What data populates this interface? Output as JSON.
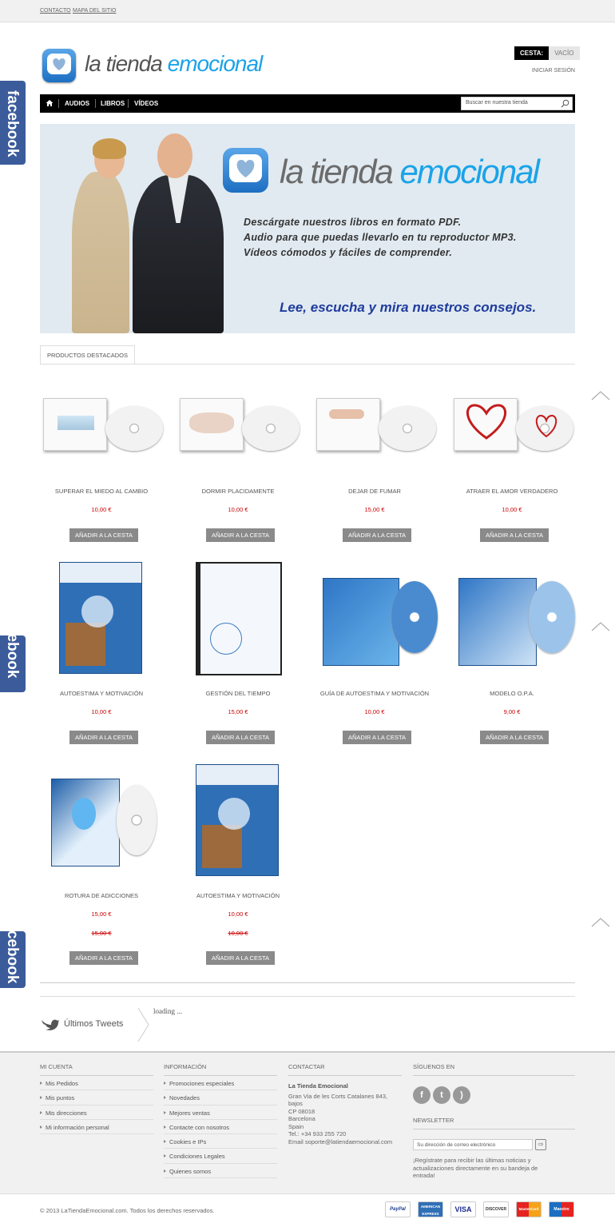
{
  "topbar": {
    "contact": "CONTACTO",
    "sitemap": "MAPA DEL SITIO"
  },
  "logo": {
    "part1": "la tienda ",
    "part2": "emocional"
  },
  "cart": {
    "label": "CESTA:",
    "value": "VACÍO"
  },
  "login": "INICIAR SESIÓN",
  "nav": {
    "items": [
      "AUDIOS",
      "LIBROS",
      "VÍDEOS"
    ]
  },
  "search": {
    "placeholder": "Buscar en nuestra tienda"
  },
  "banner": {
    "logo_part1": "la tienda ",
    "logo_part2": "emocional",
    "line1": "Descárgate nuestros libros en formato PDF.",
    "line2": "Audio para que puedas llevarlo en tu reproductor MP3.",
    "line3": "Vídeos cómodos y fáciles de comprender.",
    "slogan": "Lee, escucha y mira nuestros consejos."
  },
  "tab": "PRODUCTOS DESTACADOS",
  "button_label": "AÑADIR A LA CESTA",
  "products": [
    {
      "name": "SUPERAR EL MIEDO AL CAMBIO",
      "price": "10,00 €"
    },
    {
      "name": "DORMIR PLACIDAMENTE",
      "price": "10,00 €"
    },
    {
      "name": "DEJAR DE FUMAR",
      "price": "15,00 €"
    },
    {
      "name": "ATRAER EL AMOR VERDADERO",
      "price": "10,00 €"
    },
    {
      "name": "AUTOESTIMA Y MOTIVACIÓN",
      "price": "10,00 €"
    },
    {
      "name": "GESTIÓN DEL TIEMPO",
      "price": "15,00 €"
    },
    {
      "name": "GUÍA DE AUTOESTIMA Y MOTIVACIÓN",
      "price": "10,00 €"
    },
    {
      "name": "MODELO O.P.A.",
      "price": "9,00 €"
    },
    {
      "name": "ROTURA DE ADICCIONES",
      "price": "15,00 €",
      "old_price": "15,00 €"
    },
    {
      "name": "AUTOESTIMA Y MOTIVACIÓN",
      "price": "10,00 €",
      "old_price": "10,00 €"
    }
  ],
  "facebook_label": "facebook",
  "tweets": {
    "title": "Últimos Tweets",
    "loading": "loading ..."
  },
  "footer": {
    "account": {
      "title": "MI CUENTA",
      "items": [
        "Mis Pedidos",
        "Mis puntos",
        "Mis direcciones",
        "Mi información personal"
      ]
    },
    "info": {
      "title": "INFORMACIÓN",
      "items": [
        "Promociones especiales",
        "Novedades",
        "Mejores ventas",
        "Contacte con nosotros",
        "Cookies e IPs",
        "Condiciones Legales",
        "Quienes somos"
      ]
    },
    "contact": {
      "title": "CONTACTAR",
      "company": "La Tienda Emocional",
      "address1": "Gran Via de les Corts Catalanes 843, bajos",
      "address2": "CP 08018",
      "address3": "Barcelona",
      "address4": "Spain",
      "phone": "Tel.: +34 933 255 720",
      "email": "Email soporte@latiendaemocional.com"
    },
    "follow": {
      "title": "SÍGUENOS EN"
    },
    "newsletter": {
      "title": "NEWSLETTER",
      "placeholder": "Su dirección de correo electrónico",
      "text": "¡Regístrate para recibir las últimas noticias y actualizaciones directamente en su bandeja de entrada!"
    }
  },
  "copyright": "© 2013 LaTiendaEmocional.com. Todos los derechos reservados.",
  "payments": [
    "PayPal",
    "AMERICAN EXPRESS",
    "VISA",
    "DISCOVER",
    "MasterCard",
    "Maestro"
  ],
  "colors": {
    "accent": "#1aa3e8",
    "price": "#cc0000",
    "facebook": "#3b5b9b",
    "slogan": "#1f3c9e"
  }
}
